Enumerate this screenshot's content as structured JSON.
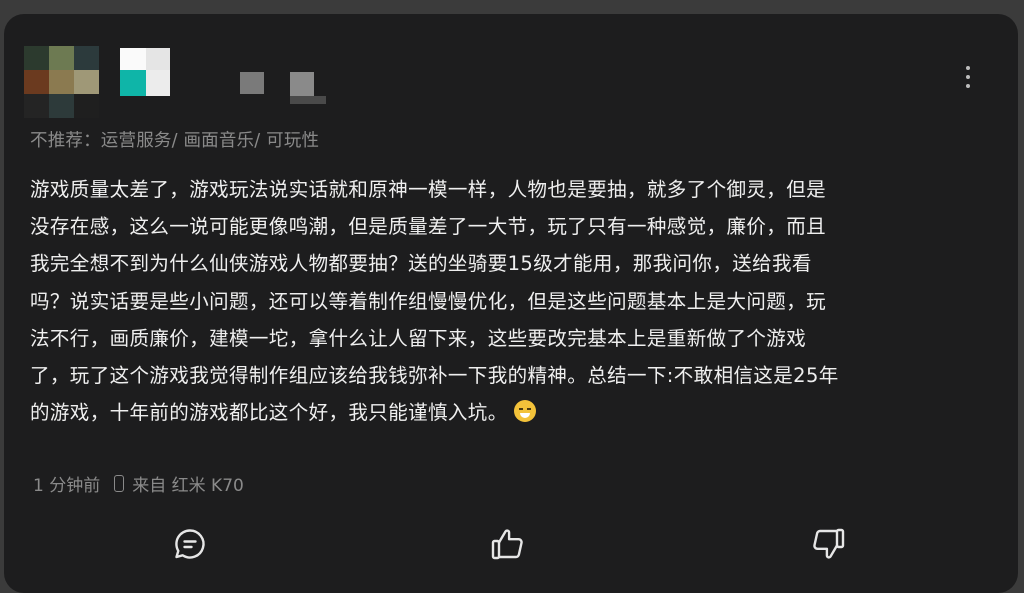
{
  "review": {
    "tags": "不推荐：运营服务/ 画面音乐/ 可玩性",
    "lines": [
      "游戏质量太差了，游戏玩法说实话就和原神一模一样，人物也是要抽，就多了个御灵，但是",
      "没存在感，这么一说可能更像鸣潮，但是质量差了一大节，玩了只有一种感觉，廉价，而且",
      "我完全想不到为什么仙侠游戏人物都要抽？送的坐骑要15级才能用，那我问你，送给我看",
      "吗？说实话要是些小问题，还可以等着制作组慢慢优化，但是这些问题基本上是大问题，玩",
      "法不行，画质廉价，建模一坨，拿什么让人留下来，这些要改完基本上是重新做了个游戏",
      "了，玩了这个游戏我觉得制作组应该给我钱弥补一下我的精神。总结一下:不敢相信这是25年",
      "的游戏，十年前的游戏都比这个好，我只能谨慎入坑。"
    ],
    "emoji": "grinning-sweat-emoji",
    "time": "1 分钟前",
    "device": "来自 红米 K70"
  },
  "icons": {
    "more": "more-vertical-icon",
    "comment": "comment-icon",
    "like": "thumbs-up-icon",
    "dislike": "thumbs-down-icon"
  },
  "colors": {
    "card_bg": "#1d1d1e",
    "text": "#efefef",
    "muted": "#8a8a8a"
  }
}
